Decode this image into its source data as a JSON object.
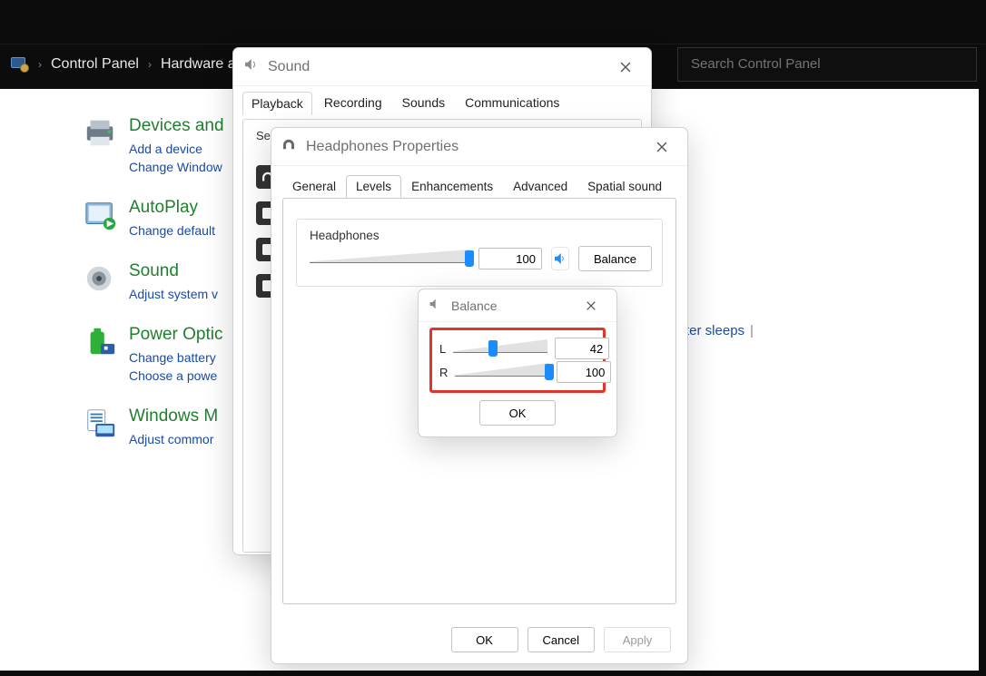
{
  "breadcrumb": {
    "root": "Control Panel",
    "section": "Hardware and"
  },
  "search": {
    "placeholder": "Search Control Panel"
  },
  "categories": [
    {
      "title": "Devices and",
      "links": [
        "Add a device",
        "Change Window"
      ]
    },
    {
      "title": "AutoPlay",
      "links": [
        "Change default"
      ]
    },
    {
      "title": "Sound",
      "links": [
        "Adjust system v"
      ]
    },
    {
      "title": "Power Optic",
      "links": [
        "Change battery",
        "Choose a powe"
      ]
    },
    {
      "title": "Windows M",
      "links": [
        "Adjust commor"
      ]
    }
  ],
  "far_link": {
    "label": "ter sleeps"
  },
  "sound": {
    "title": "Sound",
    "tabs": [
      "Playback",
      "Recording",
      "Sounds",
      "Communications"
    ],
    "active_tab": 0,
    "panel_hint": "Sel"
  },
  "props": {
    "title": "Headphones Properties",
    "tabs": [
      "General",
      "Levels",
      "Enhancements",
      "Advanced",
      "Spatial sound"
    ],
    "active_tab": 1,
    "levels": {
      "group_label": "Headphones",
      "value": 100,
      "balance_button": "Balance"
    },
    "buttons": {
      "ok": "OK",
      "cancel": "Cancel",
      "apply": "Apply"
    }
  },
  "balance": {
    "title": "Balance",
    "left_label": "L",
    "right_label": "R",
    "left_value": 42,
    "right_value": 100,
    "ok": "OK"
  }
}
